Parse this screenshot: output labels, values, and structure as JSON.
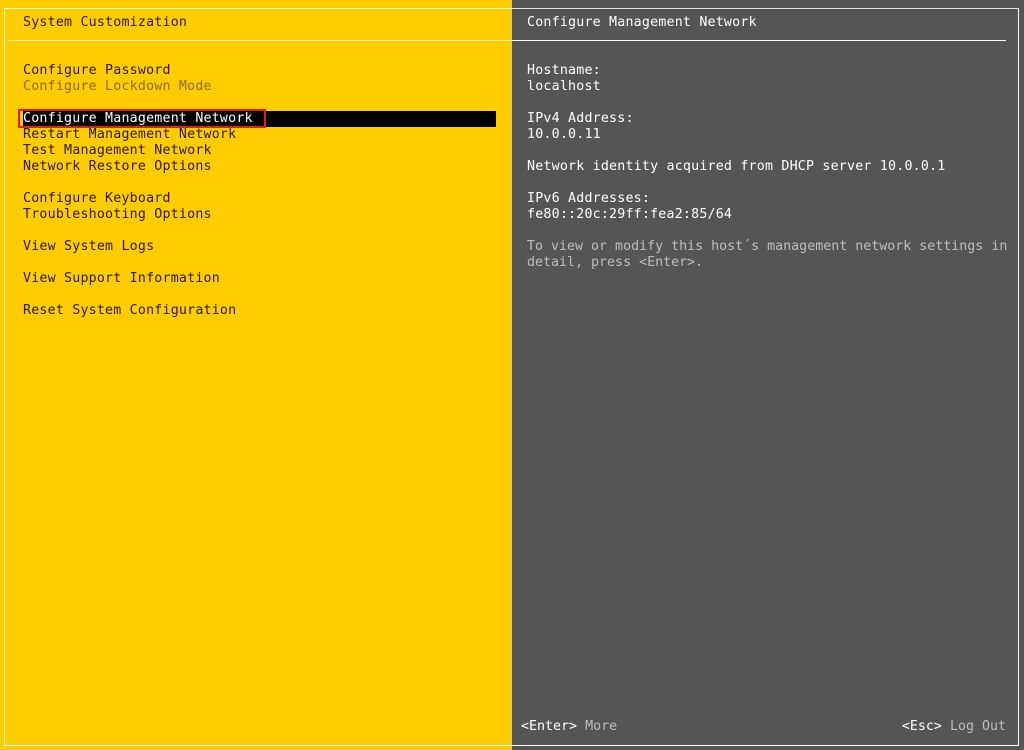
{
  "left_panel": {
    "title": "System Customization",
    "menu": [
      {
        "label": "Configure Password",
        "state": "normal"
      },
      {
        "label": "Configure Lockdown Mode",
        "state": "disabled"
      },
      {
        "gap": true
      },
      {
        "label": "Configure Management Network",
        "state": "selected"
      },
      {
        "label": "Restart Management Network",
        "state": "normal"
      },
      {
        "label": "Test Management Network",
        "state": "normal"
      },
      {
        "label": "Network Restore Options",
        "state": "normal"
      },
      {
        "gap": true
      },
      {
        "label": "Configure Keyboard",
        "state": "normal"
      },
      {
        "label": "Troubleshooting Options",
        "state": "normal"
      },
      {
        "gap": true
      },
      {
        "label": "View System Logs",
        "state": "normal"
      },
      {
        "gap": true
      },
      {
        "label": "View Support Information",
        "state": "normal"
      },
      {
        "gap": true
      },
      {
        "label": "Reset System Configuration",
        "state": "normal"
      }
    ]
  },
  "right_panel": {
    "title": "Configure Management Network",
    "hostname_label": "Hostname:",
    "hostname_value": "localhost",
    "ipv4_label": "IPv4 Address:",
    "ipv4_value": "10.0.0.11",
    "dhcp_note": "Network identity acquired from DHCP server 10.0.0.1",
    "ipv6_label": "IPv6 Addresses:",
    "ipv6_value": "fe80::20c:29ff:fea2:85/64",
    "hint": "To view or modify this host´s management network settings in detail, press <Enter>."
  },
  "footer": {
    "enter_key": "<Enter>",
    "enter_action": "More",
    "esc_key": "<Esc>",
    "esc_action": "Log Out"
  },
  "colors": {
    "left_bg": "#ffcc00",
    "right_bg": "#555555",
    "selection_bg": "#000000",
    "highlight_border": "#e02020"
  }
}
